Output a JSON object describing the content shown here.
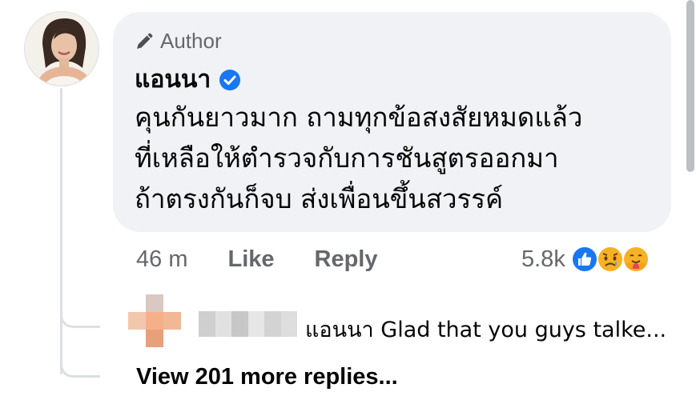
{
  "comment": {
    "badge_label": "Author",
    "author_name": "แอนนา",
    "text_lines": [
      "คุนกันยาวมาก ถามทุกข้อสงสัยหมดแล้ว",
      "ที่เหลือให้ตำรวจกับการชันสูตรออกมา",
      "ถ้าตรงกันก็จบ ส่งเพื่อนขึ้นสวรรค์"
    ],
    "time": "46 m",
    "like_label": "Like",
    "reply_label": "Reply",
    "reaction_count": "5.8k",
    "reactions": [
      "like-icon",
      "sad-icon",
      "care-icon"
    ]
  },
  "reply_preview": {
    "text": "แอนนา Glad that you guys talke..."
  },
  "view_more_label": "View 201 more replies...",
  "colors": {
    "bubble": "#f0f2f5",
    "secondary_text": "#65676b",
    "verified_blue": "#1877f2"
  }
}
